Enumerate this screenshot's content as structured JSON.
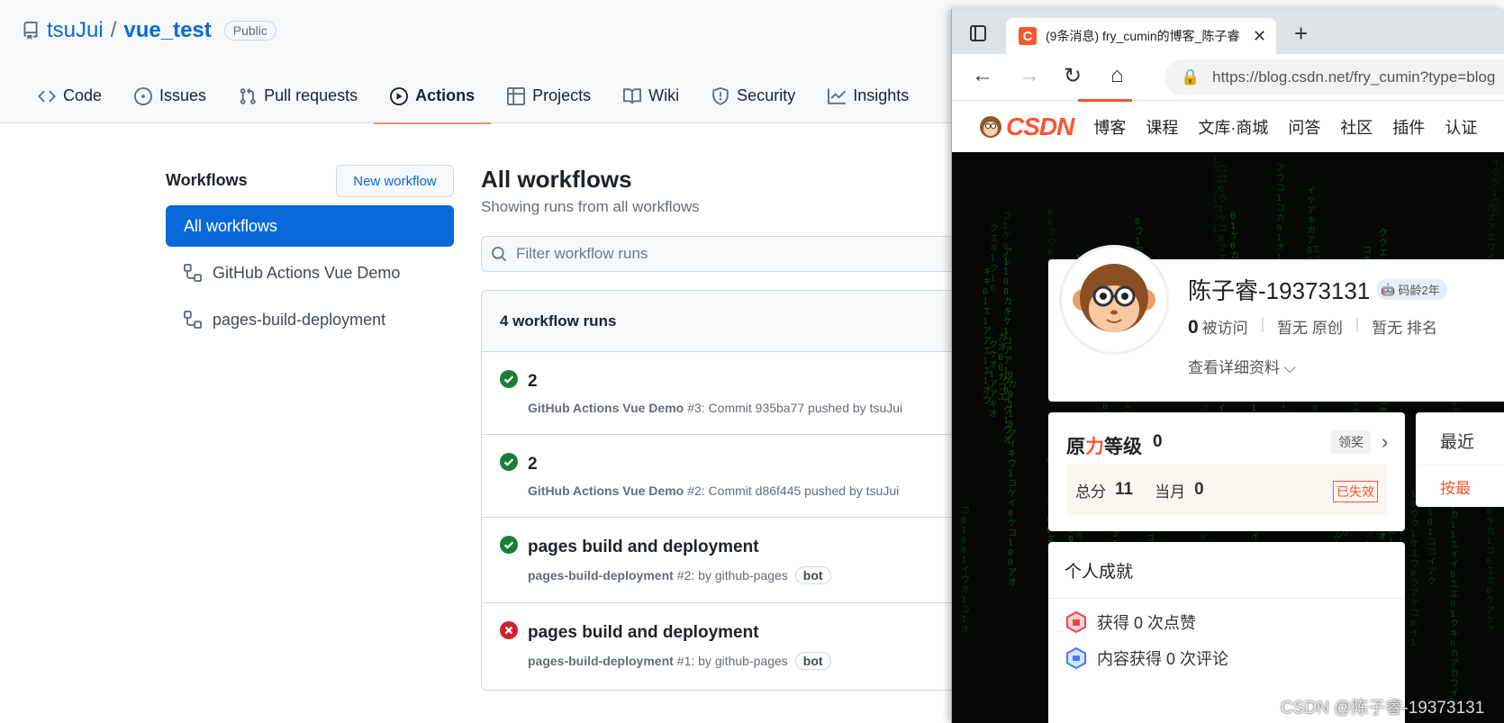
{
  "github": {
    "repo": {
      "owner": "tsuJui",
      "separator": "/",
      "name": "vue_test",
      "visibility": "Public"
    },
    "tabs": [
      {
        "label": "Code",
        "icon": "code-icon"
      },
      {
        "label": "Issues",
        "icon": "issue-icon"
      },
      {
        "label": "Pull requests",
        "icon": "pull-request-icon"
      },
      {
        "label": "Actions",
        "icon": "play-icon",
        "active": true
      },
      {
        "label": "Projects",
        "icon": "table-icon"
      },
      {
        "label": "Wiki",
        "icon": "book-icon"
      },
      {
        "label": "Security",
        "icon": "shield-icon"
      },
      {
        "label": "Insights",
        "icon": "graph-icon"
      }
    ],
    "sidebar": {
      "heading": "Workflows",
      "new_workflow": "New workflow",
      "all_workflows": "All workflows",
      "items": [
        "GitHub Actions Vue Demo",
        "pages-build-deployment"
      ]
    },
    "main": {
      "title": "All workflows",
      "subtitle": "Showing runs from all workflows",
      "filter_placeholder": "Filter workflow runs",
      "runs_count": "4 workflow runs",
      "runs": [
        {
          "status": "success",
          "title": "2",
          "workflow": "GitHub Actions Vue Demo",
          "detail": "#3: Commit 935ba77 pushed by tsuJui",
          "bot": ""
        },
        {
          "status": "success",
          "title": "2",
          "workflow": "GitHub Actions Vue Demo",
          "detail": "#2: Commit d86f445 pushed by tsuJui",
          "bot": ""
        },
        {
          "status": "success",
          "title": "pages build and deployment",
          "workflow": "pages-build-deployment",
          "detail": "#2: by github-pages",
          "bot": "bot"
        },
        {
          "status": "failure",
          "title": "pages build and deployment",
          "workflow": "pages-build-deployment",
          "detail": "#1: by github-pages",
          "bot": "bot"
        }
      ]
    },
    "colors": {
      "accent": "#0969da",
      "success": "#1a7f37",
      "failure": "#cf222e",
      "tab_underline": "#fd8c73"
    }
  },
  "browser": {
    "tab_title": "(9条消息) fry_cumin的博客_陈子睿",
    "url": "https://blog.csdn.net/fry_cumin?type=blog",
    "csdn_logo": "CSDN",
    "nav_links": [
      "博客",
      "课程",
      "文库·商城",
      "问答",
      "社区",
      "插件",
      "认证"
    ],
    "profile": {
      "name": "陈子睿-19373131",
      "age_badge": "码龄2年",
      "stats": [
        {
          "value": "0",
          "label": "被访问"
        },
        {
          "value": "暂无",
          "label": "原创"
        },
        {
          "value": "暂无",
          "label": "排名"
        }
      ],
      "detail_link": "查看详细资料"
    },
    "level": {
      "title_a": "原",
      "title_b": "力",
      "title_c": "等级",
      "value": "0",
      "award": "领奖",
      "total_label": "总分",
      "total_value": "11",
      "month_label": "当月",
      "month_value": "0",
      "expired": "已失效"
    },
    "recent": {
      "title": "最近",
      "sort": "按最"
    },
    "achievements": {
      "title": "个人成就",
      "items": [
        "获得 0 次点赞",
        "内容获得 0 次评论"
      ]
    },
    "watermark": "CSDN @陈子睿-19373131",
    "colors": {
      "brand": "#fc5531"
    }
  }
}
